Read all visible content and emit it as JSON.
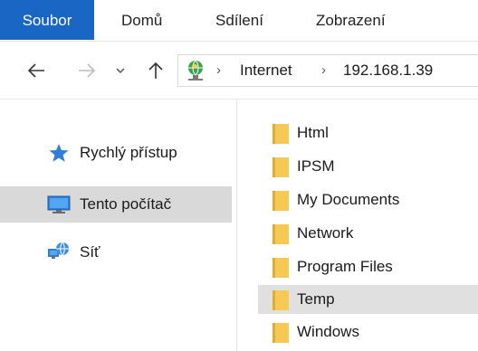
{
  "ribbon": {
    "tabs": [
      "Soubor",
      "Domů",
      "Sdílení",
      "Zobrazení"
    ]
  },
  "address_bar": {
    "icon": "network-globe-icon",
    "breadcrumbs": [
      "Internet",
      "192.168.1.39"
    ]
  },
  "nav_pane": {
    "items": [
      {
        "label": "Rychlý přístup",
        "icon": "star-icon"
      },
      {
        "label": "Tento počítač",
        "icon": "monitor-icon",
        "selected": true
      },
      {
        "label": "Síť",
        "icon": "network-icon"
      }
    ]
  },
  "file_list": {
    "items": [
      {
        "name": "Html"
      },
      {
        "name": "IPSM"
      },
      {
        "name": "My Documents"
      },
      {
        "name": "Network"
      },
      {
        "name": "Program Files"
      },
      {
        "name": "Temp",
        "selected": true
      },
      {
        "name": "Windows"
      }
    ]
  },
  "colors": {
    "file_tab": "#1a66c4",
    "folder": "#f6c955",
    "selection": "#d9d9d9"
  }
}
